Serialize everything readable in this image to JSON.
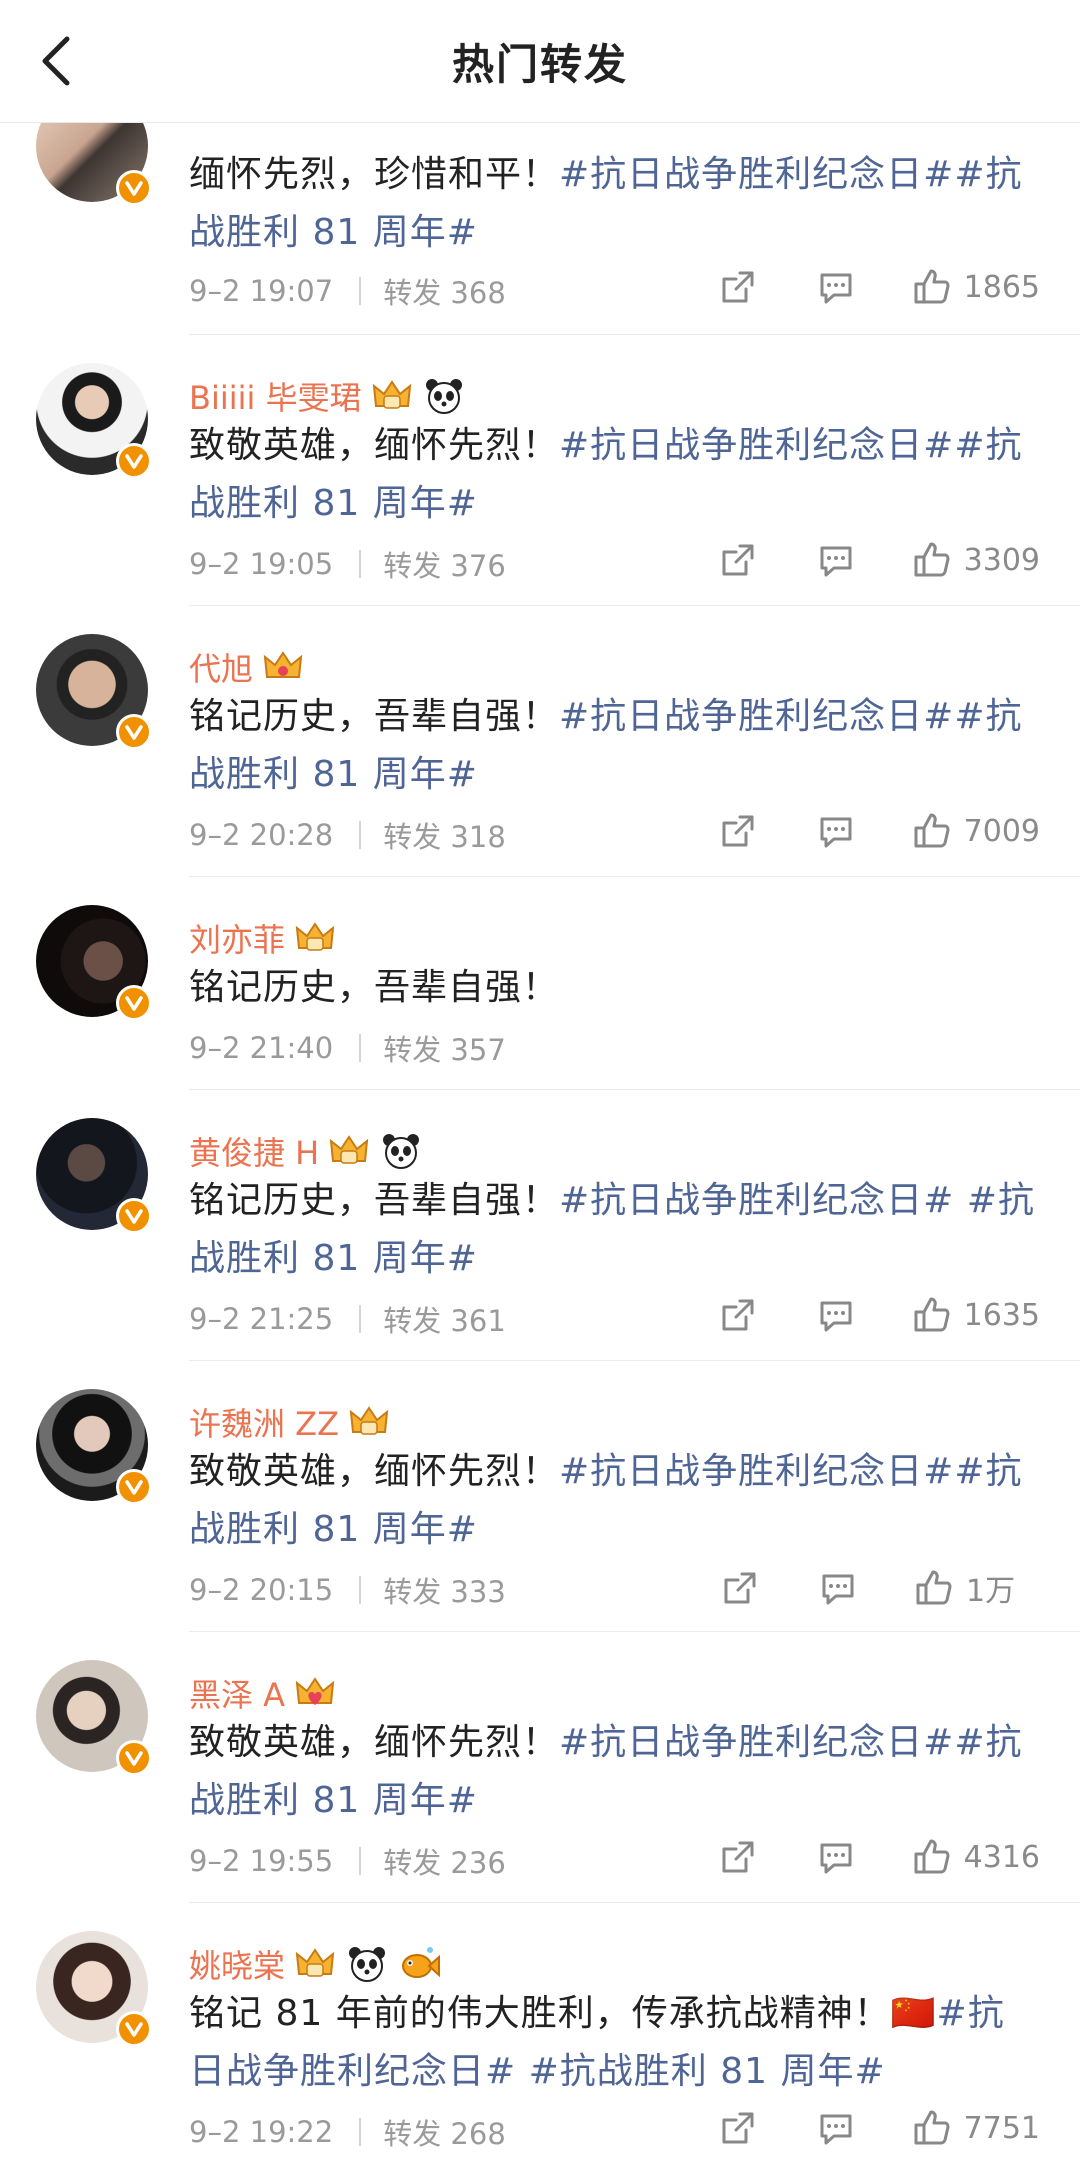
{
  "header": {
    "title": "热门转发"
  },
  "posts": [
    {
      "name": "",
      "badges": [],
      "text": "缅怀先烈，珍惜和平！",
      "tags": "#抗日战争胜利纪念日##抗战胜利 81 周年#",
      "time": "9–2 19:07",
      "repost": "转发 368",
      "likes": "1865"
    },
    {
      "name": "Biiiii 毕雯珺",
      "badges": [
        "crown",
        "panda"
      ],
      "text": "致敬英雄，缅怀先烈！",
      "tags": "#抗日战争胜利纪念日##抗战胜利 81 周年#",
      "time": "9–2 19:05",
      "repost": "转发 376",
      "likes": "3309"
    },
    {
      "name": "代旭",
      "badges": [
        "crown"
      ],
      "text": "铭记历史，吾辈自强！",
      "tags": "#抗日战争胜利纪念日##抗战胜利 81 周年#",
      "time": "9–2 20:28",
      "repost": "转发 318",
      "likes": "7009"
    },
    {
      "name": "刘亦菲",
      "badges": [
        "crown"
      ],
      "text": "铭记历史，吾辈自强！",
      "tags": "",
      "time": "9–2 21:40",
      "repost": "转发 357",
      "likes": ""
    },
    {
      "name": "黄俊捷 H",
      "badges": [
        "crown",
        "panda"
      ],
      "text": "铭记历史，吾辈自强！",
      "tags": "#抗日战争胜利纪念日# #抗战胜利 81 周年#",
      "time": "9–2 21:25",
      "repost": "转发 361",
      "likes": "1635"
    },
    {
      "name": "许魏洲 ZZ",
      "badges": [
        "crown"
      ],
      "text": "致敬英雄，缅怀先烈！",
      "tags": "#抗日战争胜利纪念日##抗战胜利 81 周年#",
      "time": "9–2 20:15",
      "repost": "转发 333",
      "likes": "1万"
    },
    {
      "name": "黑泽 A",
      "badges": [
        "crown"
      ],
      "text": "致敬英雄，缅怀先烈！",
      "tags": "#抗日战争胜利纪念日##抗战胜利 81 周年#",
      "time": "9–2 19:55",
      "repost": "转发 236",
      "likes": "4316"
    },
    {
      "name": "姚晓棠",
      "badges": [
        "crown",
        "panda",
        "fish"
      ],
      "text": "铭记 81 年前的伟大胜利，传承抗战精神！🇨🇳",
      "tags": "#抗日战争胜利纪念日# #抗战胜利 81 周年#",
      "time": "9–2 19:22",
      "repost": "转发 268",
      "likes": "7751"
    }
  ],
  "colors": {
    "name": "#eb7350",
    "tag": "#4e6596",
    "meta": "#9a9a9a",
    "verified": "#f29100"
  }
}
